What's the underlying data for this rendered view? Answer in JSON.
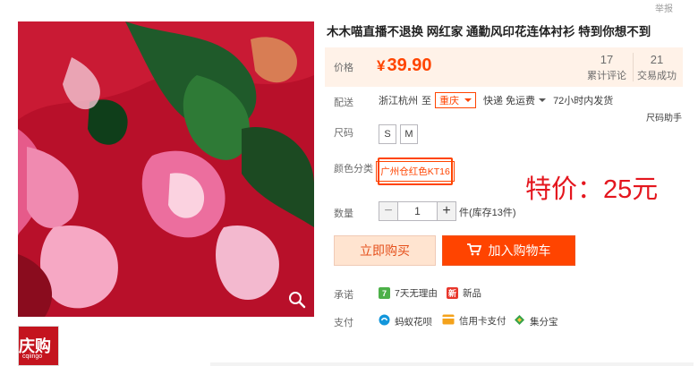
{
  "report_link": "举报",
  "gallery": {
    "thumb_text": "庆购",
    "thumb_sub": "cqiingo"
  },
  "product": {
    "title": "木木喵直播不退换 网红家 通勤风印花连体衬衫 特到你想不到"
  },
  "price": {
    "label": "价格",
    "currency": "¥",
    "amount": "39.90",
    "stats": [
      {
        "num": "17",
        "label": "累计评论"
      },
      {
        "num": "21",
        "label": "交易成功"
      }
    ]
  },
  "shipping": {
    "label": "配送",
    "from": "浙江杭州",
    "to_word": "至",
    "city": "重庆",
    "method": "快递 免运费",
    "dispatch": "72小时内发货"
  },
  "size": {
    "label": "尺码",
    "helper": "尺码助手",
    "options": [
      "S",
      "M"
    ]
  },
  "color": {
    "label": "颜色分类",
    "selected": "广州仓红色KT16"
  },
  "promo_text": "特价：25元",
  "quantity": {
    "label": "数量",
    "minus": "−",
    "value": "1",
    "plus": "+",
    "stock": "件(库存13件)"
  },
  "actions": {
    "buy_now": "立即购买",
    "add_cart": "加入购物车"
  },
  "promise": {
    "label": "承诺",
    "items": [
      {
        "icon": "seven-day-icon",
        "glyph": "7",
        "color": "#4cb048",
        "text": "7天无理由"
      },
      {
        "icon": "new-product-icon",
        "glyph": "新",
        "color": "#e8372c",
        "text": "新品"
      }
    ]
  },
  "payment": {
    "label": "支付",
    "items": [
      {
        "icon": "huabei-icon",
        "color": "#1296db",
        "text": "蚂蚁花呗"
      },
      {
        "icon": "credit-card-icon",
        "color": "#f4a21b",
        "text": "信用卡支付"
      },
      {
        "icon": "jifenbao-icon",
        "color": "#36a34a",
        "text": "集分宝"
      }
    ]
  }
}
